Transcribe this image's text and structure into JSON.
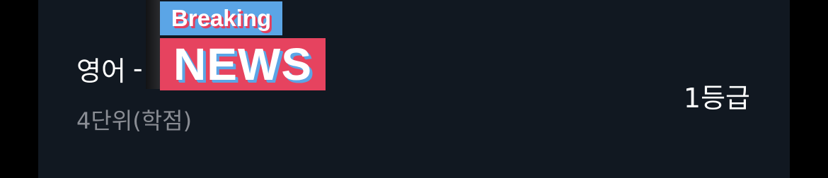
{
  "course": {
    "subject": "영어",
    "separator": "-",
    "credits": "4단위(학점)",
    "grade": "1등급"
  },
  "overlay": {
    "breaking_label": "Breaking",
    "news_label": "NEWS",
    "colors": {
      "blue": "#5ba5e6",
      "red": "#e6435f"
    }
  },
  "colors": {
    "card_background": "#111821",
    "primary_text": "#ffffff",
    "secondary_text": "#8a8d94"
  }
}
